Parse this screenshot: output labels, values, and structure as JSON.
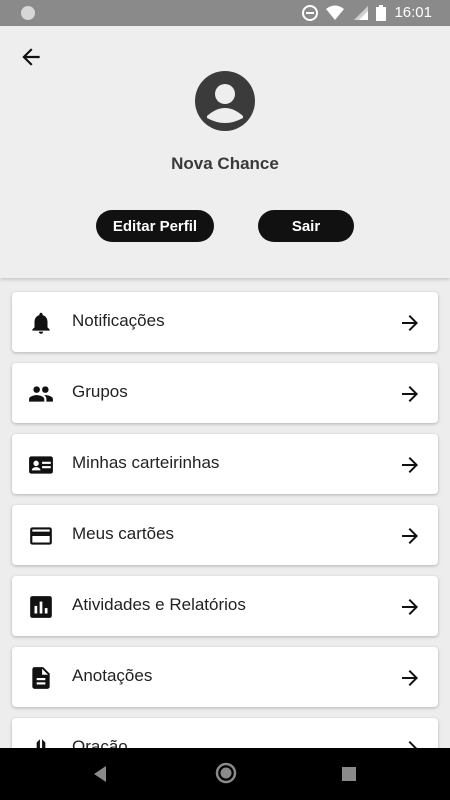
{
  "status_bar": {
    "time": "16:01"
  },
  "profile": {
    "name": "Nova Chance",
    "edit_label": "Editar Perfil",
    "exit_label": "Sair"
  },
  "menu": [
    {
      "label": "Notificações",
      "icon": "bell-icon"
    },
    {
      "label": "Grupos",
      "icon": "group-icon"
    },
    {
      "label": "Minhas carteirinhas",
      "icon": "id-card-icon"
    },
    {
      "label": "Meus cartões",
      "icon": "credit-card-icon"
    },
    {
      "label": "Atividades e Relatórios",
      "icon": "bar-chart-icon"
    },
    {
      "label": "Anotações",
      "icon": "document-icon"
    },
    {
      "label": "Oração",
      "icon": "praying-hands-icon"
    }
  ]
}
